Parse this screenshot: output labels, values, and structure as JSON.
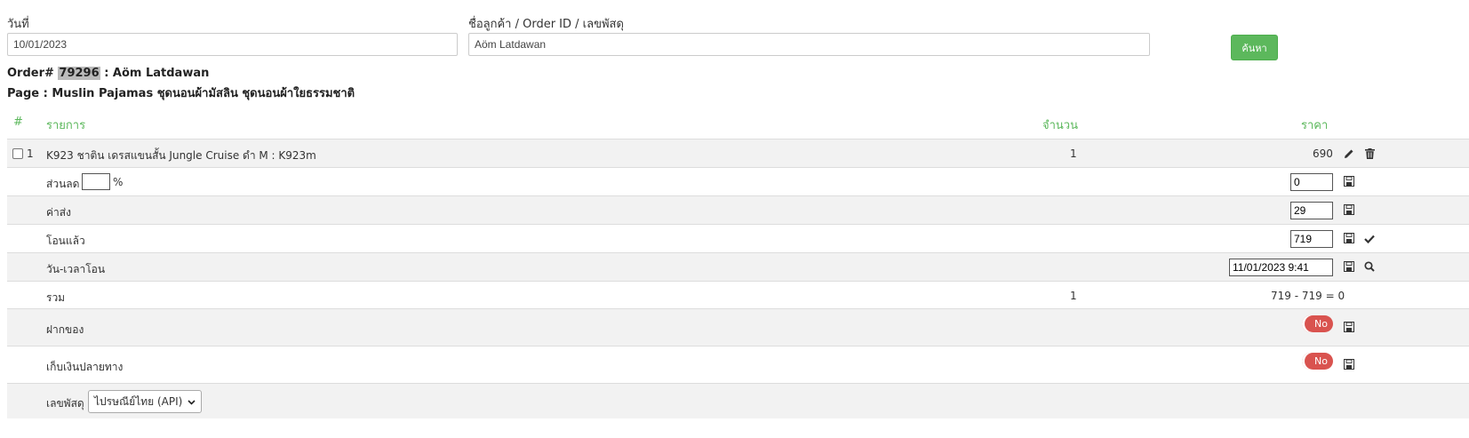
{
  "search": {
    "date_label": "วันที่",
    "date_value": "10/01/2023",
    "customer_label": "ชื่อลูกค้า / Order ID / เลขพัสดุ",
    "customer_value": "Aöm Latdawan",
    "search_button": "ค้นหา"
  },
  "order": {
    "prefix": "Order#",
    "id": "79296",
    "customer": ": Aöm Latdawan",
    "page_line": "Page : Muslin Pajamas ชุดนอนผ้ามัสลิน ชุดนอนผ้าใยธรรมชาติ"
  },
  "table": {
    "headers": {
      "index": "#",
      "item": "รายการ",
      "qty": "จำนวน",
      "price": "ราคา"
    },
    "item": {
      "index": "1",
      "name": "K923 ชาติน เดรสแขนสั้น Jungle Cruise ดำ M : K923m",
      "qty": "1",
      "price": "690"
    },
    "discount": {
      "label": "ส่วนลด",
      "unit": "%",
      "value": "0"
    },
    "shipping": {
      "label": "ค่าส่ง",
      "value": "29"
    },
    "transferred": {
      "label": "โอนแล้ว",
      "value": "719"
    },
    "transfer_time": {
      "label": "วัน-เวลาโอน",
      "value": "11/01/2023 9:41"
    },
    "total": {
      "label": "รวม",
      "qty": "1",
      "formula": "719 - 719 = 0"
    },
    "deposit": {
      "label": "ฝากของ",
      "toggle": "No"
    },
    "cod": {
      "label": "เก็บเงินปลายทาง",
      "toggle": "No"
    },
    "tracking": {
      "label": "เลขพัสดุ",
      "carrier": "ไปรษณีย์ไทย (API)"
    }
  },
  "colors": {
    "accent_green": "#5cb85c",
    "toggle_red": "#d9534f",
    "stripe": "#f2f2f2"
  },
  "icons": [
    "pencil-icon",
    "trash-icon",
    "save-icon",
    "check-icon",
    "search-icon",
    "chevron-down-icon"
  ]
}
